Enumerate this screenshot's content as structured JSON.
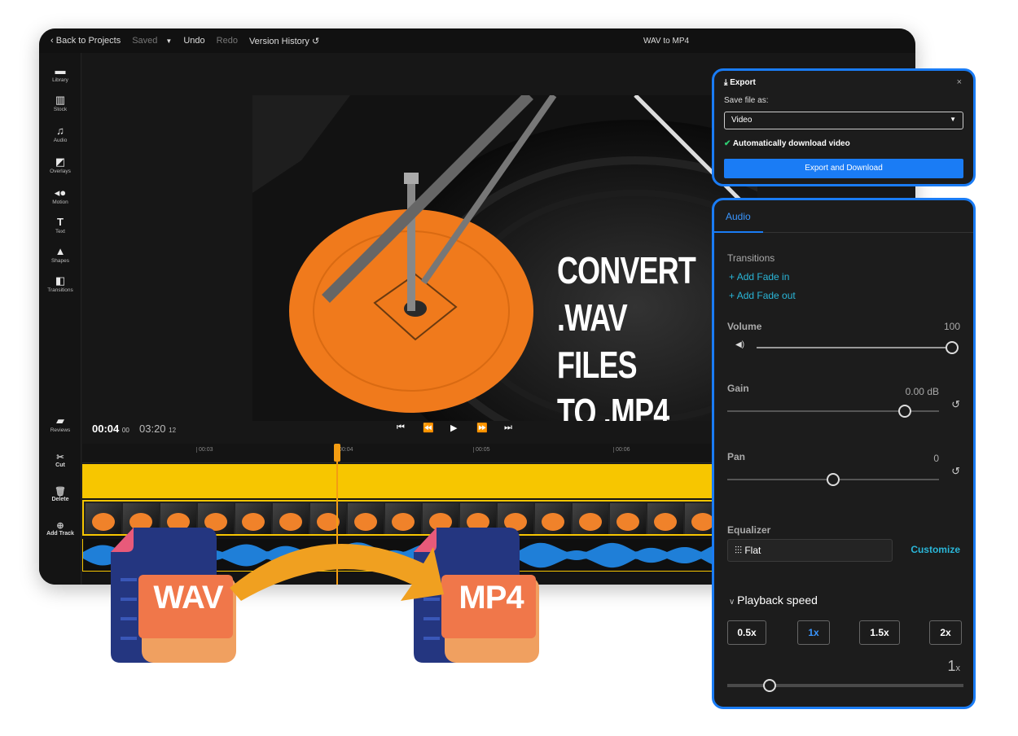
{
  "topbar": {
    "back_label": "Back to Projects",
    "saved_label": "Saved",
    "undo_label": "Undo",
    "redo_label": "Redo",
    "version_history_label": "Version History",
    "project_title": "WAV to MP4"
  },
  "sidebar": {
    "items": [
      {
        "label": "Library",
        "icon": "folder-icon"
      },
      {
        "label": "Stock",
        "icon": "stock-icon"
      },
      {
        "label": "Audio",
        "icon": "music-note-icon"
      },
      {
        "label": "Overlays",
        "icon": "overlay-icon"
      },
      {
        "label": "Motion",
        "icon": "motion-icon"
      },
      {
        "label": "Text",
        "icon": "text-icon"
      },
      {
        "label": "Shapes",
        "icon": "shapes-icon"
      },
      {
        "label": "Transitions",
        "icon": "transitions-icon"
      },
      {
        "label": "Reviews",
        "icon": "comments-icon"
      }
    ]
  },
  "video": {
    "overlay_line1": "CONVERT",
    "overlay_line2": ".WAV FILES",
    "overlay_line3": "TO .MP4"
  },
  "playback": {
    "current_time": "00:04",
    "current_frames": "00",
    "total_time": "03:20",
    "total_frames": "12"
  },
  "timeline": {
    "ticks": [
      "00:03",
      "00:04",
      "00:05",
      "00:06"
    ],
    "tools": [
      {
        "label": "Cut",
        "icon": "scissors-icon"
      },
      {
        "label": "Delete",
        "icon": "trash-icon"
      },
      {
        "label": "Add Track",
        "icon": "add-track-icon"
      }
    ]
  },
  "export_panel": {
    "title": "Export",
    "save_as_label": "Save file as:",
    "format_value": "Video",
    "auto_download_label": "Automatically download video",
    "export_button": "Export and Download"
  },
  "audio_panel": {
    "tab_label": "Audio",
    "transitions_label": "Transitions",
    "add_fade_in": "Add Fade in",
    "add_fade_out": "Add Fade out",
    "volume_label": "Volume",
    "volume_value": "100",
    "volume_level": 1.0,
    "gain_label": "Gain",
    "gain_value": "0.00 dB",
    "gain_level": 0.84,
    "pan_label": "Pan",
    "pan_value": "0",
    "pan_level": 0.5,
    "equalizer_label": "Equalizer",
    "equalizer_value": "Flat",
    "customize_label": "Customize",
    "playback_speed_label": "Playback speed",
    "speed_options": [
      "0.5x",
      "1x",
      "1.5x",
      "2x"
    ],
    "selected_speed": "1x",
    "speed_display": "1",
    "speed_unit": "x",
    "speed_level": 0.18
  },
  "badges": {
    "source_format": "WAV",
    "target_format": "MP4"
  },
  "colors": {
    "accent_blue": "#1a7cf5",
    "timeline_yellow": "#f7c600",
    "arrow_orange": "#f0a020",
    "file_navy": "#243680",
    "badge_orange": "#f0774a"
  }
}
